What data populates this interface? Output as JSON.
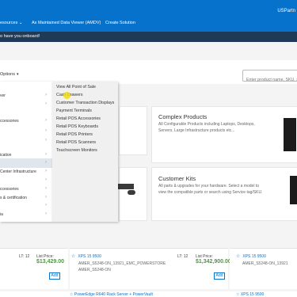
{
  "header": {
    "nav_links": [
      "esources",
      "As Maintained Data Viewer (AMDV)",
      "Create Solution"
    ],
    "nav_caret": "⌄",
    "user": "USPartn"
  },
  "welcome": {
    "text": "o have you onboard!"
  },
  "toolbar": {
    "options_label": "Options",
    "options_caret": "▾",
    "search_placeholder": "Enter product name, SKU, ser"
  },
  "menu": {
    "left_items": [
      {
        "label": "ver",
        "arrow": "›"
      },
      {
        "label": "ccessories",
        "arrow": "›"
      },
      {
        "label": "",
        "arrow": "›"
      },
      {
        "label": "",
        "arrow": "›"
      },
      {
        "label": "",
        "arrow": "›"
      },
      {
        "label": "ication",
        "arrow": "›"
      },
      {
        "label": "",
        "arrow": "›"
      },
      {
        "label": "Center Infrastructure",
        "arrow": "›"
      },
      {
        "label": "",
        "arrow": "›"
      },
      {
        "label": "ccessories",
        "arrow": "›"
      },
      {
        "label": "s & certification",
        "arrow": "›"
      },
      {
        "label": "",
        "arrow": "›"
      },
      {
        "label": "ia",
        "arrow": "›"
      }
    ],
    "sub_items": [
      "View All Point of Sale",
      "Cash Drawers",
      "Customer Transaction Displays",
      "Payment Terminals",
      "Retail POS Accessories",
      "Retail POS Keyboards",
      "Retail POS Printers",
      "Retail POS Scanners",
      "Touchscreen Monitors"
    ]
  },
  "cards": {
    "complex": {
      "title": "Complex Products",
      "desc": "All Configurable Products including Laptops, Desktops, Servers, Large Infrastructure products etc..."
    },
    "custom": {
      "title": "Customer Kits",
      "desc": "All parts & upgrades for your hardware. Select a model to view the compatible parts or search using Service tag/SKU."
    }
  },
  "products": [
    {
      "lt": "LT: 12",
      "list_price_label": "List Price:",
      "price": "$13,429.00",
      "add": "Add",
      "sku": "XPS 15 9500",
      "code1": "AMER_S5248-ON_13921_EMC_POWERSTORE",
      "code2": "AMER_S5248-ON"
    },
    {
      "lt": "LT: 12",
      "list_price_label": "List Price:",
      "price": "$1,342,900.00",
      "add": "Add",
      "sku": "XPS 15 9500",
      "code1": "AMER_S5248-ON_13921",
      "code2": ""
    }
  ],
  "bottom": {
    "sku1": "PowerEdge R640 Rack Server + PowerVault",
    "sku2": "XPS 15 9500"
  },
  "colors": {
    "brand": "#0672cb",
    "dark": "#1f3a57",
    "price_green": "#4b9a3c"
  },
  "icons": {
    "star": "☆"
  }
}
